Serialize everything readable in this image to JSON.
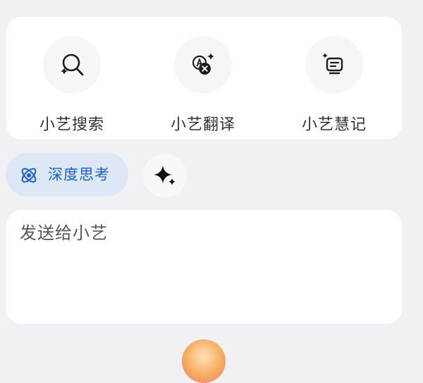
{
  "quick_actions": [
    {
      "label": "小艺搜索",
      "icon": "search-sparkle-icon"
    },
    {
      "label": "小艺翻译",
      "icon": "translate-icon"
    },
    {
      "label": "小艺慧记",
      "icon": "notes-icon"
    }
  ],
  "deep_think": {
    "label": "深度思考",
    "icon": "deep-think-orbit-icon"
  },
  "sparkle_button": {
    "icon": "sparkle-icon"
  },
  "input": {
    "placeholder": "发送给小艺"
  },
  "colors": {
    "background": "#f1f1f3",
    "card": "#ffffff",
    "chip_bg": "#dde8f7",
    "chip_text": "#1a5fd6",
    "text": "#333333"
  }
}
